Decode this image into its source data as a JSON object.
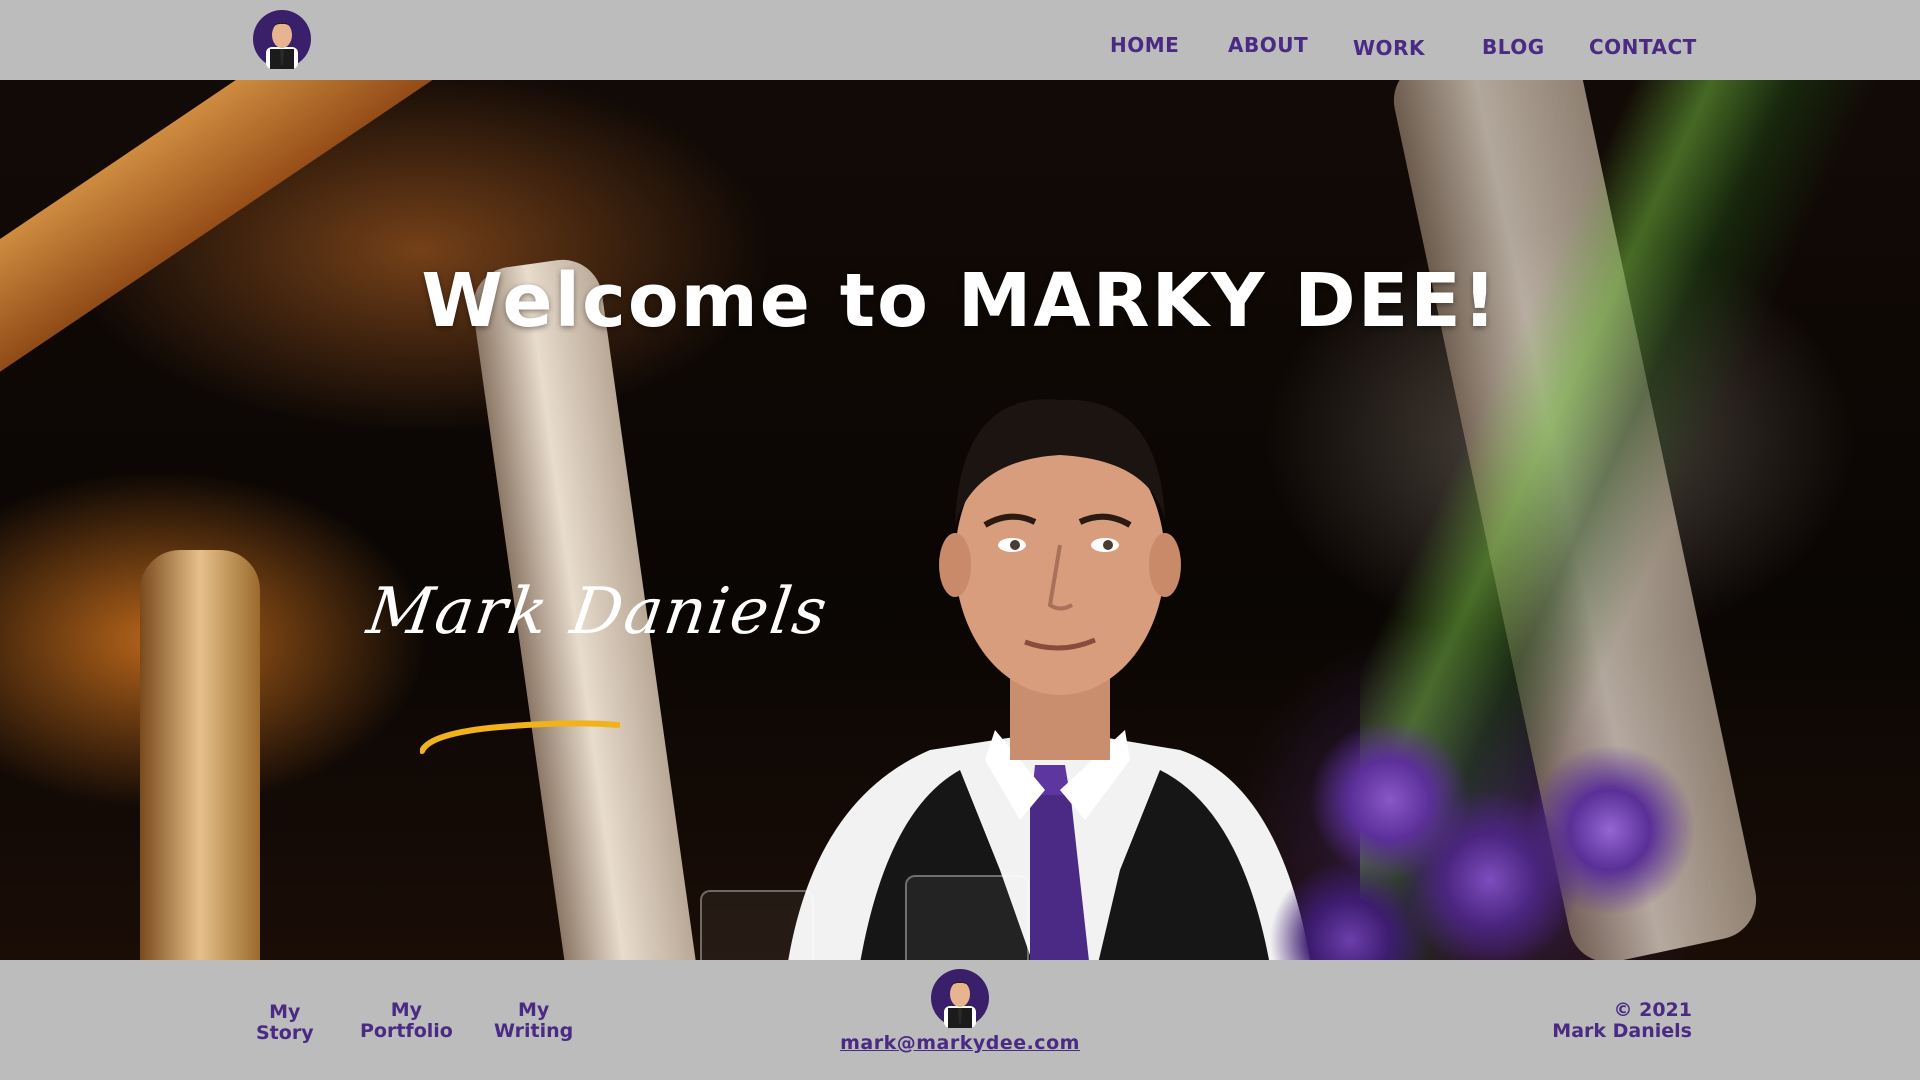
{
  "header": {
    "logo_icon": "cartoon-avatar-icon",
    "nav": [
      {
        "label": "HOME"
      },
      {
        "label": "ABOUT"
      },
      {
        "label": "WORK"
      },
      {
        "label": "BLOG"
      },
      {
        "label": "CONTACT"
      }
    ]
  },
  "hero": {
    "title": "Welcome to MARKY DEE!",
    "signature": "Mark Daniels"
  },
  "footer": {
    "links": [
      {
        "line1": "My",
        "line2": "Story"
      },
      {
        "line1": "My",
        "line2": "Portfolio"
      },
      {
        "line1": "My",
        "line2": "Writing"
      }
    ],
    "logo_icon": "cartoon-avatar-icon",
    "email": "mark@markydee.com",
    "copyright_line1": "© 2021",
    "copyright_line2": "Mark Daniels"
  },
  "colors": {
    "bar_bg": "#bcbcbc",
    "accent_purple": "#4a2a82",
    "signature_underline": "#f2b21b"
  }
}
